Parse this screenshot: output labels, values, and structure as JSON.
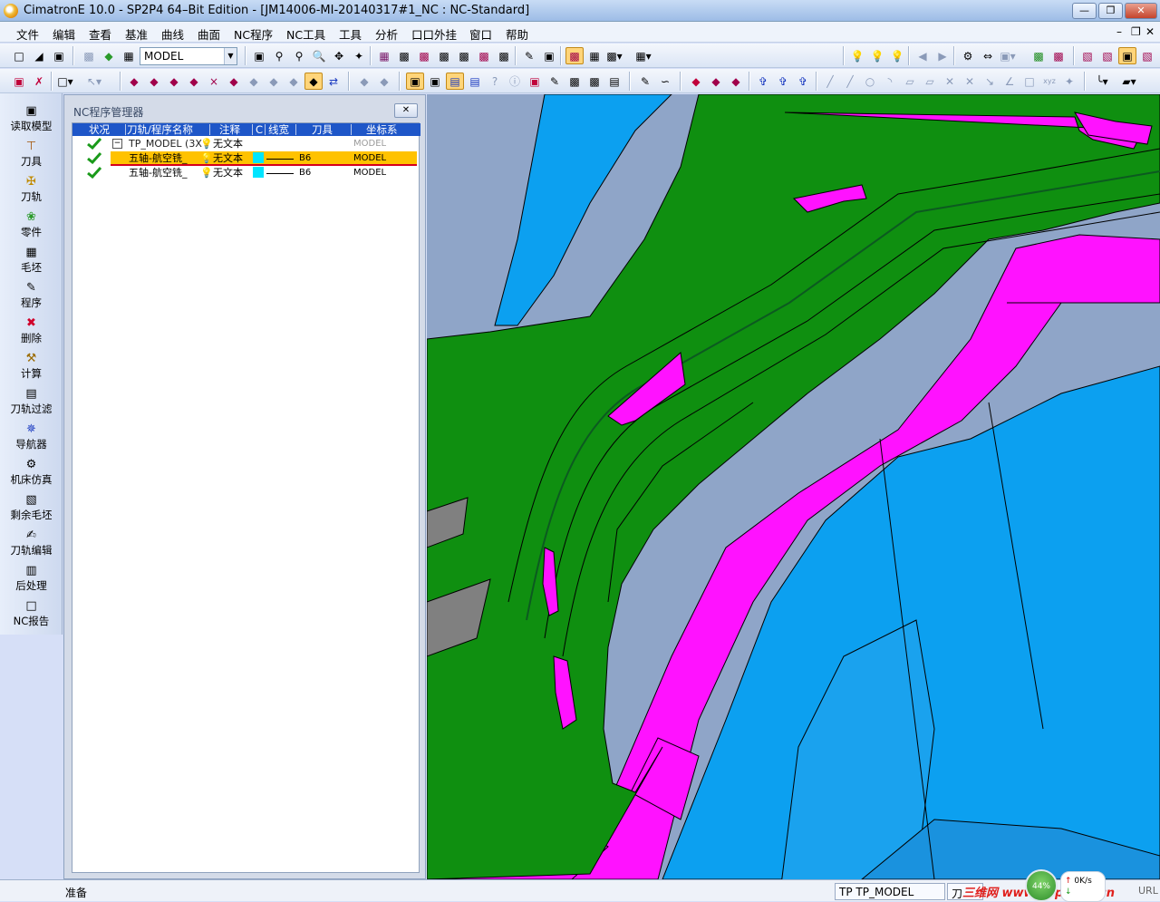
{
  "window": {
    "title": "CimatronE 10.0 - SP2P4 64–Bit Edition - [JM14006-MI-20140317#1_NC : NC-Standard]",
    "minimize": "—",
    "restore": "❐",
    "close": "✕"
  },
  "menu": {
    "items": [
      "文件",
      "编辑",
      "查看",
      "基准",
      "曲线",
      "曲面",
      "NC程序",
      "NC工具",
      "工具",
      "分析",
      "口口外挂",
      "窗口",
      "帮助"
    ],
    "mdi_minimize": "–",
    "mdi_restore": "❐",
    "mdi_close": "✕"
  },
  "toolbar": {
    "model_select": "MODEL",
    "model_dropdown_arrow": "▼"
  },
  "left_toolbar": {
    "items": [
      {
        "label": "读取模型",
        "icon": "read-model-icon"
      },
      {
        "label": "刀具",
        "icon": "tool-icon"
      },
      {
        "label": "刀轨",
        "icon": "toolpath-icon"
      },
      {
        "label": "零件",
        "icon": "part-icon"
      },
      {
        "label": "毛坯",
        "icon": "stock-icon"
      },
      {
        "label": "程序",
        "icon": "procedure-icon"
      },
      {
        "label": "删除",
        "icon": "delete-icon"
      },
      {
        "label": "计算",
        "icon": "execute-icon"
      },
      {
        "label": "刀轨过滤",
        "icon": "filter-icon"
      },
      {
        "label": "导航器",
        "icon": "navigator-icon"
      },
      {
        "label": "机床仿真",
        "icon": "simulation-icon"
      },
      {
        "label": "剩余毛坯",
        "icon": "remaining-stock-icon"
      },
      {
        "label": "刀轨编辑",
        "icon": "toolpath-edit-icon"
      },
      {
        "label": "后处理",
        "icon": "post-process-icon"
      },
      {
        "label": "NC报告",
        "icon": "nc-report-icon"
      }
    ]
  },
  "nc_panel": {
    "title": "NC程序管理器",
    "close": "✕",
    "columns": [
      "状况",
      "刀轨/程序名称",
      "注释",
      "C",
      "线宽",
      "刀具",
      "坐标系"
    ],
    "rows": [
      {
        "expander": "−",
        "name": "TP_MODEL (3X",
        "comment": "无文本",
        "color": "",
        "tool": "",
        "ucs": "MODEL",
        "selected": false
      },
      {
        "expander": "",
        "name": "五轴-航空铣_",
        "comment": "无文本",
        "color": "#00e5ff",
        "tool": "B6",
        "ucs": "MODEL",
        "selected": true
      },
      {
        "expander": "",
        "name": "五轴-航空铣_",
        "comment": "无文本",
        "color": "#00e5ff",
        "tool": "B6",
        "ucs": "MODEL",
        "selected": false
      }
    ]
  },
  "status": {
    "ready": "准备",
    "toolpath": "TP_MODEL",
    "toolpath_prefix": "TP",
    "tool_label": "刀",
    "net_percent": "44%",
    "net_speed": "0K/s",
    "net_up": "↑",
    "net_down": "↓",
    "watermark": "三维网 www.3dportal.cn",
    "url_label": "URL"
  },
  "viewport": {
    "colors": {
      "green": "#0f8f10",
      "magenta": "#ff12ff",
      "blue": "#0ca0f0",
      "gray": "#808080",
      "dark_blue": "#1a73b8"
    }
  }
}
